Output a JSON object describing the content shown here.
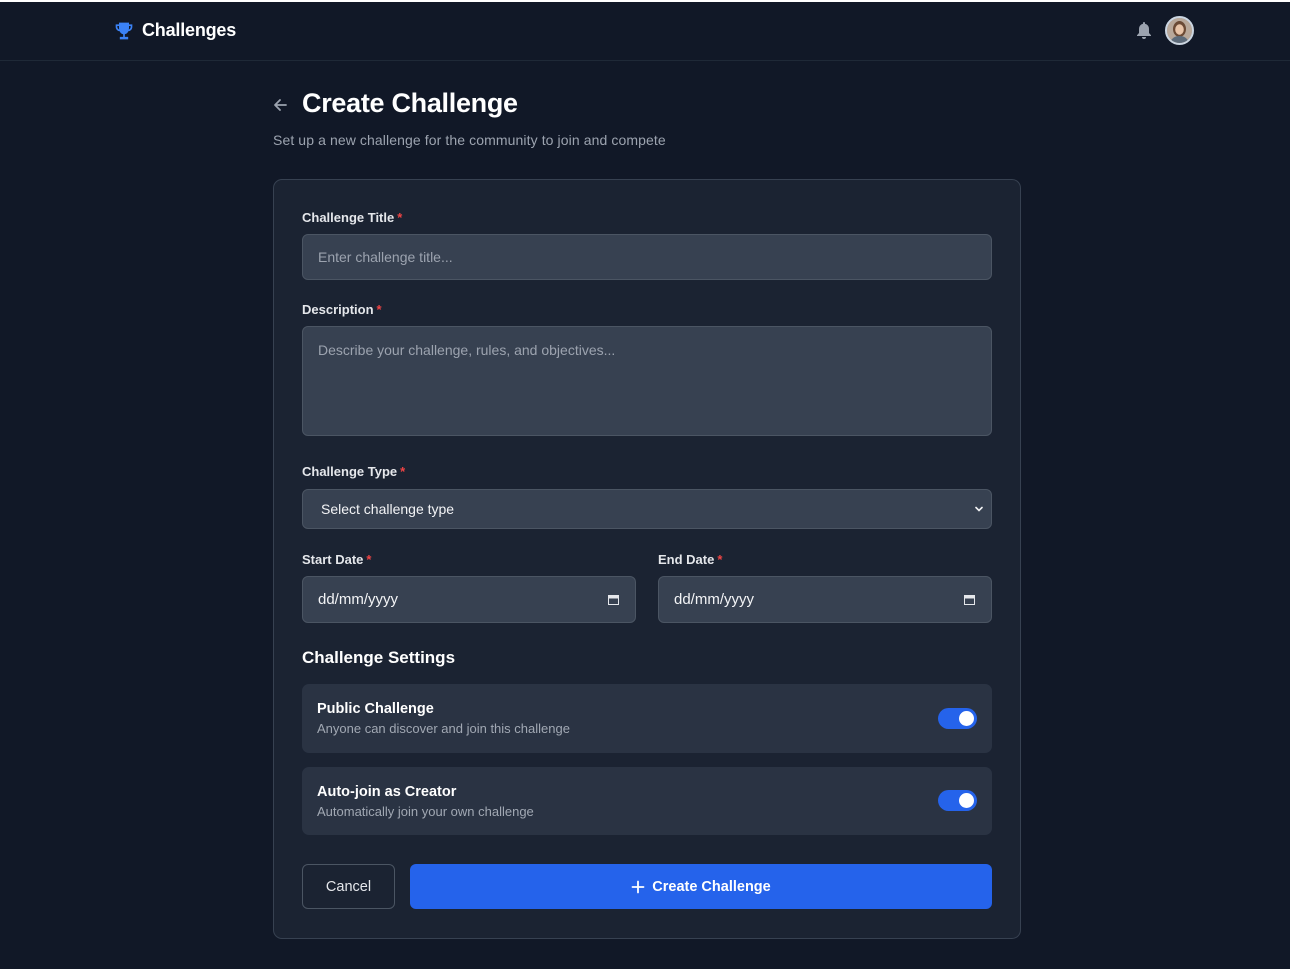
{
  "header": {
    "brand": "Challenges",
    "icons": [
      "trophy-icon",
      "bell-icon"
    ]
  },
  "page": {
    "title": "Create Challenge",
    "subtitle": "Set up a new challenge for the community to join and compete"
  },
  "form": {
    "title_label": "Challenge Title",
    "title_placeholder": "Enter challenge title...",
    "description_label": "Description",
    "description_placeholder": "Describe your challenge, rules, and objectives...",
    "type_label": "Challenge Type",
    "type_selected": "Select challenge type",
    "start_label": "Start Date",
    "start_value": "dd/mm/yyyy",
    "end_label": "End Date",
    "end_value": "dd/mm/yyyy",
    "required_mark": "*"
  },
  "settings": {
    "title": "Challenge Settings",
    "items": [
      {
        "title": "Public Challenge",
        "description": "Anyone can discover and join this challenge",
        "enabled": true
      },
      {
        "title": "Auto-join as Creator",
        "description": "Automatically join your own challenge",
        "enabled": true
      }
    ]
  },
  "actions": {
    "cancel": "Cancel",
    "create": "Create Challenge"
  },
  "colors": {
    "background": "#111827",
    "card": "#1b2332",
    "accent": "#2563eb",
    "required": "#ef4444"
  }
}
